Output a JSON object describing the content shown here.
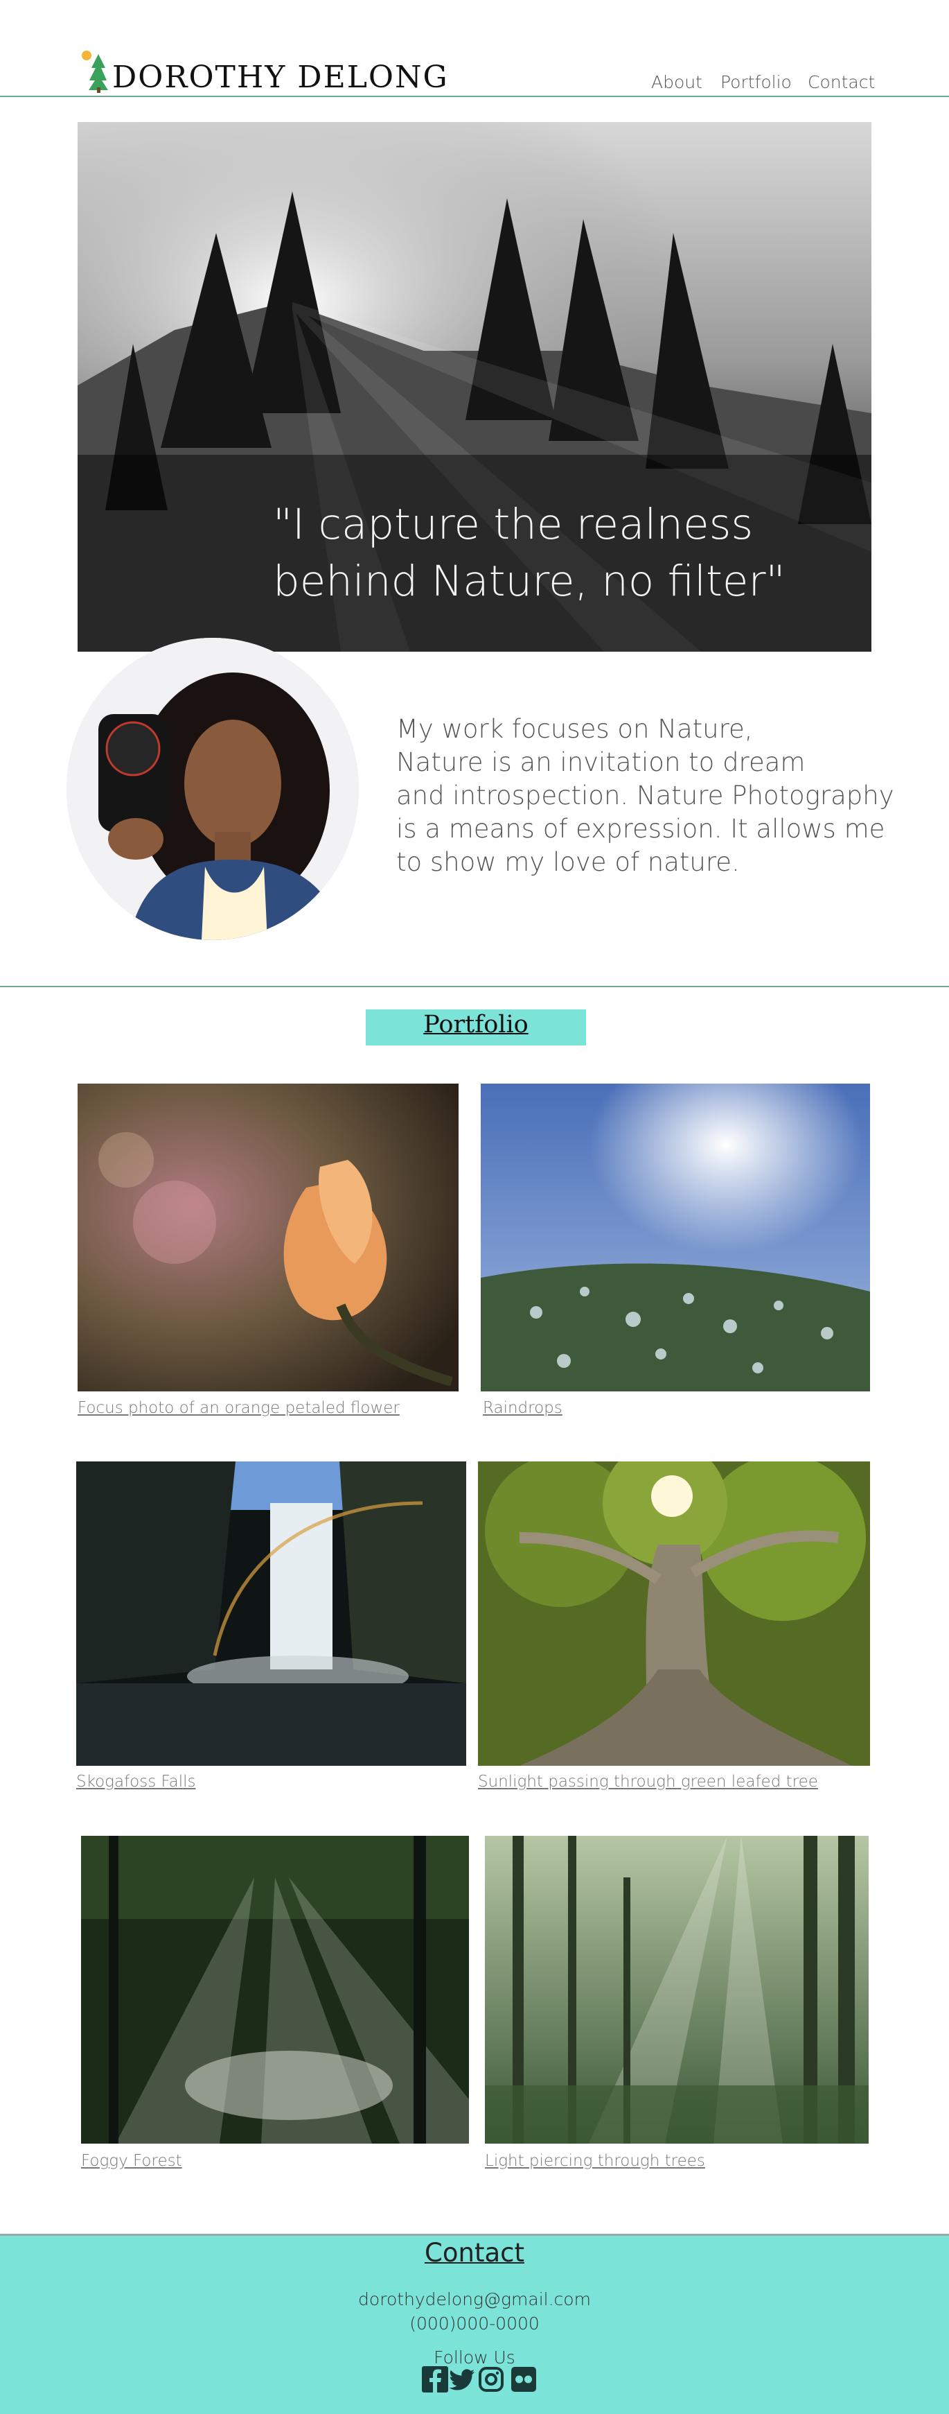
{
  "header": {
    "brand": "DOROTHY DELONG",
    "nav": [
      {
        "label": "About"
      },
      {
        "label": "Portfolio"
      },
      {
        "label": "Contact"
      }
    ]
  },
  "hero": {
    "quote_line1": "\"I capture the realness",
    "quote_line2": "behind Nature, no filter\""
  },
  "about": {
    "lines": [
      "My work focuses on Nature,",
      "Nature is an invitation to dream",
      "and introspection. Nature Photography",
      "is a means of expression. It allows me",
      "to show my love of nature."
    ]
  },
  "portfolio": {
    "title": "Portfolio",
    "items": [
      {
        "caption": "Focus photo of an orange petaled flower"
      },
      {
        "caption": "Raindrops"
      },
      {
        "caption": "Skogafoss Falls"
      },
      {
        "caption": "Sunlight passing through green leafed tree"
      },
      {
        "caption": "Foggy Forest"
      },
      {
        "caption": "Light piercing through trees"
      }
    ]
  },
  "footer": {
    "title": "Contact",
    "email": "dorothydelong@gmail.com",
    "phone": "(000)000-0000",
    "follow": "Follow Us",
    "social": [
      "facebook-icon",
      "twitter-icon",
      "instagram-icon",
      "flickr-icon"
    ]
  },
  "colors": {
    "accent": "#7be3d8",
    "rule": "#6fa896"
  }
}
